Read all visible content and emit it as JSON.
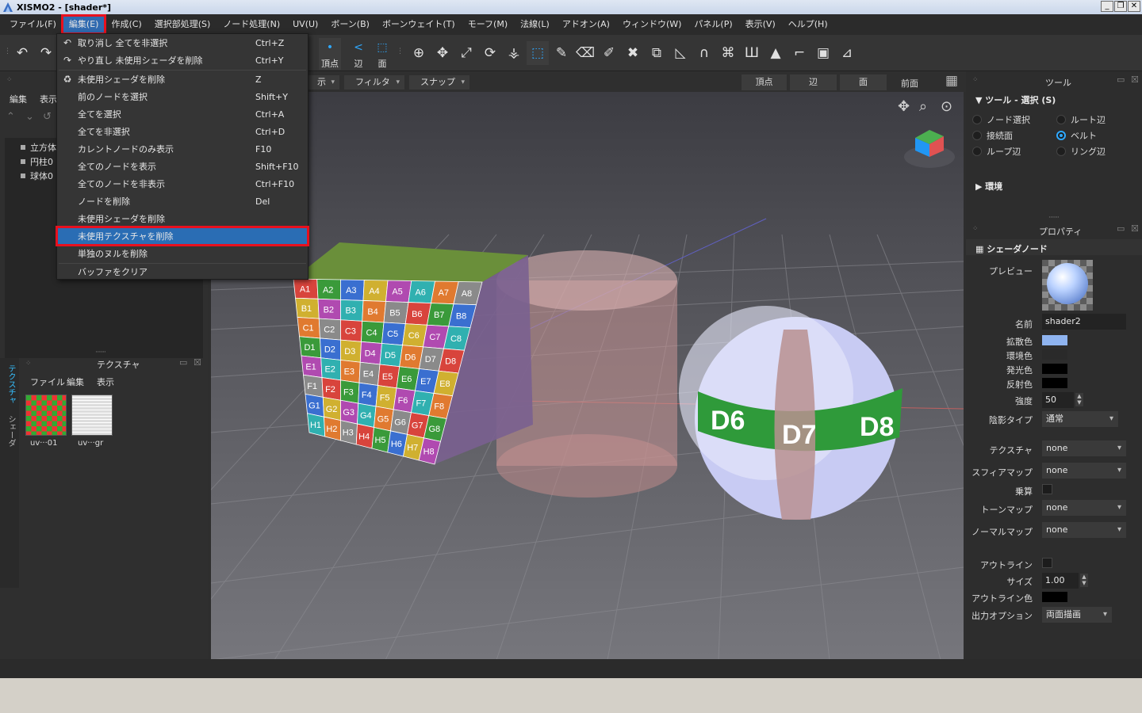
{
  "window": {
    "title": "XISMO2 - [shader*]",
    "controls": [
      "_",
      "❐",
      "✕"
    ]
  },
  "menubar": [
    "ファイル(F)",
    "編集(E)",
    "作成(C)",
    "選択部処理(S)",
    "ノード処理(N)",
    "UV(U)",
    "ボーン(B)",
    "ボーンウェイト(T)",
    "モーフ(M)",
    "法線(L)",
    "アドオン(A)",
    "ウィンドウ(W)",
    "パネル(P)",
    "表示(V)",
    "ヘルプ(H)"
  ],
  "toolbar": {
    "modes": [
      "頂点",
      "辺",
      "面"
    ]
  },
  "left_panel": {
    "menu": [
      "編集",
      "表示"
    ],
    "tree": [
      "立方体",
      "円柱0",
      "球体0"
    ],
    "texture_panel": {
      "title": "テクスチャ",
      "menu": [
        "ファイル",
        "編集",
        "表示"
      ],
      "thumbnails": [
        "uv···01",
        "uv···gr"
      ]
    },
    "side_tabs": [
      "テクスチャ",
      "シェーダ"
    ]
  },
  "edit_menu": {
    "items": [
      {
        "icon": "undo-icon",
        "label": "取り消し 全てを非選択",
        "shortcut": "Ctrl+Z"
      },
      {
        "icon": "redo-icon",
        "label": "やり直し 未使用シェーダを削除",
        "shortcut": "Ctrl+Y"
      },
      {
        "icon": "recycle-icon",
        "label": "未使用シェーダを削除",
        "shortcut": "Z"
      },
      {
        "icon": "",
        "label": "前のノードを選択",
        "shortcut": "Shift+Y"
      },
      {
        "icon": "",
        "label": "全てを選択",
        "shortcut": "Ctrl+A"
      },
      {
        "icon": "",
        "label": "全てを非選択",
        "shortcut": "Ctrl+D"
      },
      {
        "icon": "",
        "label": "カレントノードのみ表示",
        "shortcut": "F10"
      },
      {
        "icon": "",
        "label": "全てのノードを表示",
        "shortcut": "Shift+F10"
      },
      {
        "icon": "",
        "label": "全てのノードを非表示",
        "shortcut": "Ctrl+F10"
      },
      {
        "icon": "",
        "label": "ノードを削除",
        "shortcut": "Del"
      },
      {
        "icon": "",
        "label": "未使用シェーダを削除",
        "shortcut": ""
      },
      {
        "icon": "",
        "label": "未使用テクスチャを削除",
        "shortcut": ""
      },
      {
        "icon": "",
        "label": "単独のヌルを削除",
        "shortcut": ""
      },
      {
        "icon": "",
        "label": "バッファをクリア",
        "shortcut": ""
      }
    ]
  },
  "viewport_bar": {
    "dropdowns": [
      "示",
      "フィルタ",
      "スナップ"
    ],
    "tabs": [
      "頂点",
      "辺",
      "面"
    ],
    "view_name": "前面"
  },
  "viewport": {
    "cube_labels": [
      "A1",
      "A2",
      "A3",
      "A4",
      "A5",
      "A6",
      "A7",
      "A8",
      "B1",
      "B2",
      "B3",
      "B4",
      "B5",
      "B6",
      "B7",
      "B8",
      "C1",
      "C2",
      "C3",
      "C4",
      "C5",
      "C6",
      "C7",
      "C8",
      "D1",
      "D2",
      "D3",
      "D4",
      "D5",
      "D6",
      "D7",
      "D8",
      "E1",
      "E2",
      "E3",
      "E4",
      "E5",
      "E6",
      "E7",
      "E8",
      "F1",
      "F2",
      "F3",
      "F4",
      "F5",
      "F6",
      "F7",
      "F8",
      "G1",
      "G2",
      "G3",
      "G4",
      "G5",
      "G6",
      "G7",
      "G8",
      "H1",
      "H2",
      "H3",
      "H4",
      "H5",
      "H6",
      "H7",
      "H8"
    ],
    "sphere_labels": [
      "D6",
      "D7",
      "D8"
    ]
  },
  "tool_panel": {
    "title": "ツール",
    "section": "ツール - 選択 (S)",
    "radios_left": [
      "ノード選択",
      "接続面",
      "ループ辺"
    ],
    "radios_right": [
      "ルート辺",
      "ベルト",
      "リング辺"
    ],
    "selected": "ベルト",
    "env": "環境"
  },
  "property_panel": {
    "title": "プロパティ",
    "section": "シェーダノード",
    "preview_label": "プレビュー",
    "name_label": "名前",
    "name_value": "shader2",
    "colors": [
      {
        "label": "拡散色",
        "color": "#8fb4f0"
      },
      {
        "label": "環境色",
        "color": "#2a2a2a"
      },
      {
        "label": "発光色",
        "color": "#000000"
      },
      {
        "label": "反射色",
        "color": "#000000"
      }
    ],
    "strength_label": "強度",
    "strength_value": "50",
    "shading_label": "陰影タイプ",
    "shading_value": "通常",
    "maps": [
      {
        "label": "テクスチャ",
        "value": "none"
      },
      {
        "label": "スフィアマップ",
        "value": "none"
      }
    ],
    "multiply_label": "乗算",
    "maps2": [
      {
        "label": "トーンマップ",
        "value": "none"
      },
      {
        "label": "ノーマルマップ",
        "value": "none"
      }
    ],
    "outline_label": "アウトライン",
    "size_label": "サイズ",
    "size_value": "1.00",
    "outline_color_label": "アウトライン色",
    "output_label": "出力オプション",
    "output_value": "両面描画"
  }
}
